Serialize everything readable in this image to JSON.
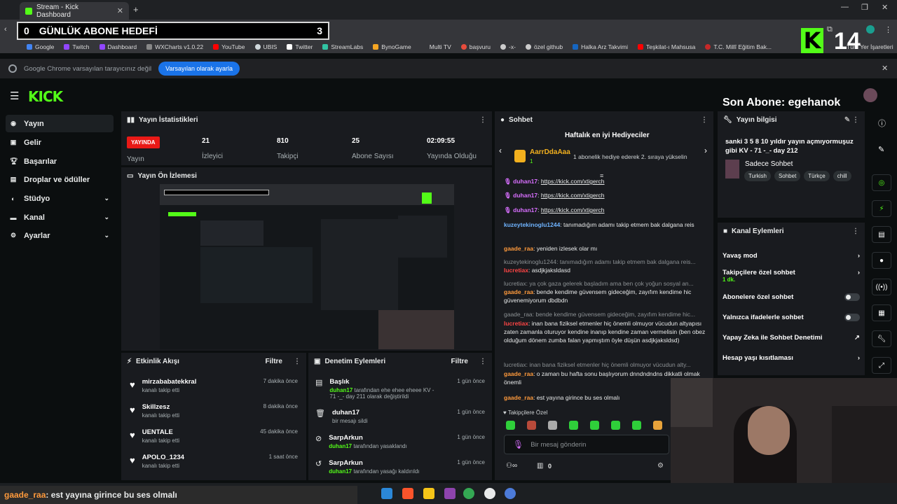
{
  "browser": {
    "tab_title": "Stream - Kick Dashboard",
    "address": "dashboard",
    "bookmarks": [
      "Google",
      "Twitch",
      "Dashboard",
      "WXCharts v1.0.22",
      "YouTube",
      "UBIS",
      "Twitter",
      "StreamLabs",
      "BynoGame",
      "Multi TV",
      "başvuru",
      "-x-",
      "özel github",
      "Halka Arz Takvimi",
      "Teşkilat-ı Mahsusa",
      "T.C. Millî Eğitim Bak..."
    ],
    "bookmarks_right": "Tüm Yer İşaretleri",
    "info_text": "Google Chrome varsayılan tarayıcınız değil",
    "info_button": "Varsayılan olarak ayarla"
  },
  "overlay": {
    "goal_left": "0",
    "goal_title": "GÜNLÜK ABONE HEDEFİ",
    "goal_count": "3",
    "kick_count": "14",
    "last_sub": "Son Abone: egehanok",
    "bottom_user": "gaade_raa",
    "bottom_msg": ": est yayına girince bu ses olmalı"
  },
  "sidebar": {
    "items": [
      {
        "label": "Yayın",
        "icon": "stream-icon"
      },
      {
        "label": "Gelir",
        "icon": "revenue-icon"
      },
      {
        "label": "Başarılar",
        "icon": "trophy-icon"
      },
      {
        "label": "Droplar ve ödüller",
        "icon": "gift-icon"
      },
      {
        "label": "Stüdyo",
        "icon": "studio-icon"
      },
      {
        "label": "Kanal",
        "icon": "channel-icon"
      },
      {
        "label": "Ayarlar",
        "icon": "settings-icon"
      }
    ]
  },
  "stats": {
    "title": "Yayın İstatistikleri",
    "live": "YAYINDA",
    "live_label": "Yayın",
    "viewers": "21",
    "viewers_label": "İzleyici",
    "followers": "810",
    "followers_label": "Takipçi",
    "subs": "25",
    "subs_label": "Abone Sayısı",
    "uptime": "02:09:55",
    "uptime_label": "Yayında Olduğu"
  },
  "preview": {
    "title": "Yayın Ön İzlemesi"
  },
  "activity": {
    "title": "Etkinlik Akışı",
    "filter": "Filtre",
    "items": [
      {
        "name": "mirzababatekkral",
        "sub": "kanalı takip etti",
        "time": "7 dakika önce"
      },
      {
        "name": "Skillzesz",
        "sub": "kanalı takip etti",
        "time": "8 dakika önce"
      },
      {
        "name": "UENTALE",
        "sub": "kanalı takip etti",
        "time": "45 dakika önce"
      },
      {
        "name": "APOLO_1234",
        "sub": "kanalı takip etti",
        "time": "1 saat önce"
      }
    ]
  },
  "moderation": {
    "title": "Denetim Eylemleri",
    "filter": "Filtre",
    "items": [
      {
        "name": "Başlık",
        "user": "duhan17",
        "text": " tarafından ehe ehee eheee KV - 71 -_- day 211 olarak değiştirildi",
        "time": "1 gün önce"
      },
      {
        "name": "duhan17",
        "user": "",
        "text": "bir mesajı sildi",
        "time": "1 gün önce"
      },
      {
        "name": "SarpArkun",
        "user": "duhan17",
        "text": " tarafından yasaklandı",
        "time": "1 gün önce"
      },
      {
        "name": "SarpArkun",
        "user": "duhan17",
        "text": " tarafından yasağı kaldırıldı",
        "time": "1 gün önce"
      }
    ]
  },
  "chat": {
    "title": "Sohbet",
    "gifters_title": "Haftalık en iyi Hediyeciler",
    "gifter_name": "AarrDdaAaa",
    "gifter_count": "1",
    "gifter_hint": "1 abonelik hediye ederek 2. sıraya yükselin",
    "link_user": "duhan17",
    "link": "https://kick.com/xtigerch",
    "messages": [
      {
        "user": "kuzeytekinoglu1244",
        "text": ": tanımadığım adamı takip etmem bak dalgana reis"
      },
      {
        "user": "gaade_raa",
        "text": ": yeniden izlesek olar mı"
      },
      {
        "reply": "kuzeytekinoglu1244: tanımadığım adamı takip etmem bak dalgana reis...",
        "user": "lucretiax",
        "text": ": asdjkjaksldasd"
      },
      {
        "reply": "lucretiax: ya çok gaza gelerek başladım ama ben çok yoğun sosyal an...",
        "user": "gaade_raa",
        "text": ": bende kendime güvensem gideceğim, zayıfım kendime hic güvenemiyorum dbdbdn"
      },
      {
        "reply": "gaade_raa: bende kendime güvensem gideceğim, zayıfım kendime hic...",
        "user": "lucretiax",
        "text": ": inan bana fiziksel etmenler hiç önemli olmuyor vücudun altyapısı zaten zamanla oturuyor kendine inanıp kendine zaman vermelisin (ben obez olduğum dönem zumba falan yapmıştım öyle düşün asdjkjaksldsd)"
      },
      {
        "reply": "lucretiax: inan bana fiziksel etmenler hiç önemli olmuyor vücudun alty...",
        "user": "gaade_raa",
        "text": ": o zaman bu hafta sonu başlıyorum dnndndndns dikkatli olmak önemli"
      },
      {
        "user": "gaade_raa",
        "text": ": est yayına girince bu ses olmalı"
      }
    ],
    "followers_only": "Takipçilere Özel",
    "input_placeholder": "Bir mesaj gönderin",
    "points": "0"
  },
  "stream_info": {
    "title": "Yayın bilgisi",
    "stream_title": "sanki 3 5 8 10 yıldır yayın açmıyormuşuz gibi KV - 71 -_- day 212",
    "category": "Sadece Sohbet",
    "tags": [
      "Turkish",
      "Sohbet",
      "Türkçe",
      "chill"
    ]
  },
  "channel_actions": {
    "title": "Kanal Eylemleri",
    "slow": "Yavaş mod",
    "followers": "Takipçilere özel sohbet",
    "followers_sub": "1 dk.",
    "subs": "Abonelere özel sohbet",
    "emotes": "Yalnızca ifadelerle sohbet",
    "ai": "Yapay Zeka ile Sohbet Denetimi",
    "age": "Hesap yaşı kısıtlaması"
  },
  "colors": {
    "accent": "#53fc18",
    "live": "#e91916",
    "panel": "#191b1f",
    "bg": "#0b0e0f"
  }
}
